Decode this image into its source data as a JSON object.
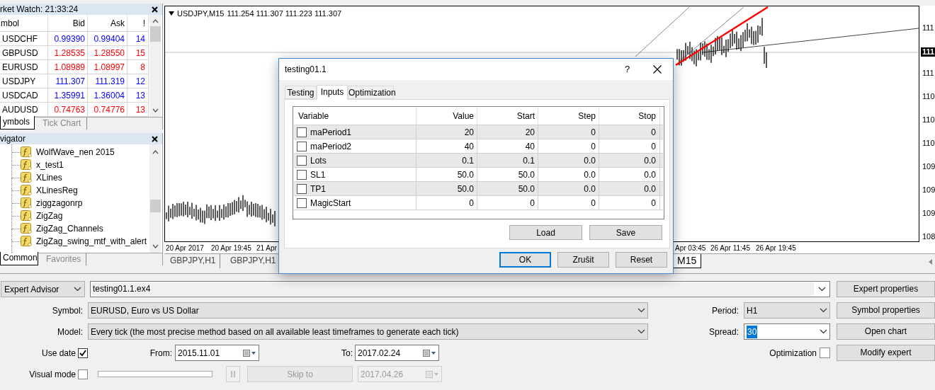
{
  "market_watch": {
    "title": "rket Watch: 21:33:24",
    "columns": [
      "mbol",
      "Bid",
      "Ask",
      "!"
    ],
    "rows": [
      {
        "symbol": "USDCHF",
        "bid": "0.99390",
        "ask": "0.99404",
        "spread": "14",
        "color": "#0000ff"
      },
      {
        "symbol": "GBPUSD",
        "bid": "1.28535",
        "ask": "1.28550",
        "spread": "15",
        "color": "#ff0000"
      },
      {
        "symbol": "EURUSD",
        "bid": "1.08989",
        "ask": "1.08997",
        "spread": "8",
        "color": "#ff0000"
      },
      {
        "symbol": "USDJPY",
        "bid": "111.307",
        "ask": "111.319",
        "spread": "12",
        "color": "#0000ff"
      },
      {
        "symbol": "USDCAD",
        "bid": "1.35991",
        "ask": "1.36004",
        "spread": "13",
        "color": "#0000ff"
      },
      {
        "symbol": "AUDUSD",
        "bid": "0.74763",
        "ask": "0.74776",
        "spread": "13",
        "color": "#ff0000"
      }
    ],
    "tabs": [
      {
        "label": "ymbols",
        "selected": true
      },
      {
        "label": "Tick Chart",
        "selected": false
      }
    ]
  },
  "navigator": {
    "title": "vigator",
    "items": [
      "WolfWave_nen 2015",
      "x_test1",
      "XLines",
      "XLinesReg",
      "ziggzagonrp",
      "ZigZag",
      "ZigZag_Channels",
      "ZigZag_swing_mtf_with_alert"
    ],
    "tabs": [
      {
        "label": "Common",
        "selected": true
      },
      {
        "label": "Favorites",
        "selected": false
      }
    ]
  },
  "chart": {
    "title": "USDJPY,M15",
    "ohlc": "111.254 111.307 111.223 111.307",
    "price_labels": [
      {
        "label": "111",
        "kind": "tick"
      },
      {
        "label": "111",
        "kind": "current"
      },
      {
        "label": "111",
        "kind": "tick"
      },
      {
        "label": "110",
        "kind": "tick"
      },
      {
        "label": "110",
        "kind": "tick"
      },
      {
        "label": "110",
        "kind": "tick"
      },
      {
        "label": "109",
        "kind": "tick"
      },
      {
        "label": "109",
        "kind": "tick"
      },
      {
        "label": "109",
        "kind": "tick"
      },
      {
        "label": "108",
        "kind": "tick"
      }
    ],
    "time_labels": [
      "20 Apr 2017",
      "20 Apr 19:45",
      "21 Apr",
      "Apr 03:45",
      "26 Apr 11:45",
      "26 Apr 19:45"
    ],
    "tabs": [
      {
        "label": "GBPJPY,H1",
        "selected": false
      },
      {
        "label": "GBPJPY,H1",
        "selected": false
      },
      {
        "label": "M15",
        "selected": true
      }
    ]
  },
  "dialog": {
    "title": "testing01.1",
    "help": "?",
    "tabs": [
      {
        "label": "Testing",
        "selected": false
      },
      {
        "label": "Inputs",
        "selected": true
      },
      {
        "label": "Optimization",
        "selected": false
      }
    ],
    "columns": [
      "Variable",
      "Value",
      "Start",
      "Step",
      "Stop"
    ],
    "rows": [
      {
        "variable": "maPeriod1",
        "checked": false,
        "value": "20",
        "start": "20",
        "step": "0",
        "stop": "0"
      },
      {
        "variable": "maPeriod2",
        "checked": false,
        "value": "40",
        "start": "40",
        "step": "0",
        "stop": "0"
      },
      {
        "variable": "Lots",
        "checked": false,
        "value": "0.1",
        "start": "0.1",
        "step": "0.0",
        "stop": "0.0"
      },
      {
        "variable": "SL1",
        "checked": false,
        "value": "50.0",
        "start": "50.0",
        "step": "0.0",
        "stop": "0.0"
      },
      {
        "variable": "TP1",
        "checked": false,
        "value": "50.0",
        "start": "50.0",
        "step": "0.0",
        "stop": "0.0"
      },
      {
        "variable": "MagicStart",
        "checked": false,
        "value": "0",
        "start": "0",
        "step": "0",
        "stop": "0"
      }
    ],
    "panel_buttons": [
      "Load",
      "Save"
    ],
    "buttons": [
      {
        "label": "OK",
        "default": true
      },
      {
        "label": "Zrušit",
        "default": false
      },
      {
        "label": "Reset",
        "default": false
      }
    ]
  },
  "tester": {
    "mode": "Expert Advisor",
    "expert": "testing01.1.ex4",
    "symbol_label": "Symbol:",
    "symbol": "EURUSD, Euro vs US Dollar",
    "period_label": "Period:",
    "period": "H1",
    "model_label": "Model:",
    "model": "Every tick (the most precise method based on all available least timeframes to generate each tick)",
    "spread_label": "Spread:",
    "spread": "30",
    "use_date": {
      "label": "Use date",
      "checked": true
    },
    "from_label": "From:",
    "from": "2015.11.01",
    "to_label": "To:",
    "to": "2017.02.24",
    "optimization": {
      "label": "Optimization",
      "checked": false
    },
    "visual_mode": {
      "label": "Visual mode",
      "checked": false
    },
    "pause": {
      "disabled": true
    },
    "skip": {
      "label": "Skip to",
      "disabled": true
    },
    "skip_date": {
      "value": "2017.04.26",
      "disabled": true
    },
    "buttons": [
      "Expert properties",
      "Symbol properties",
      "Open chart",
      "Modify expert"
    ]
  }
}
